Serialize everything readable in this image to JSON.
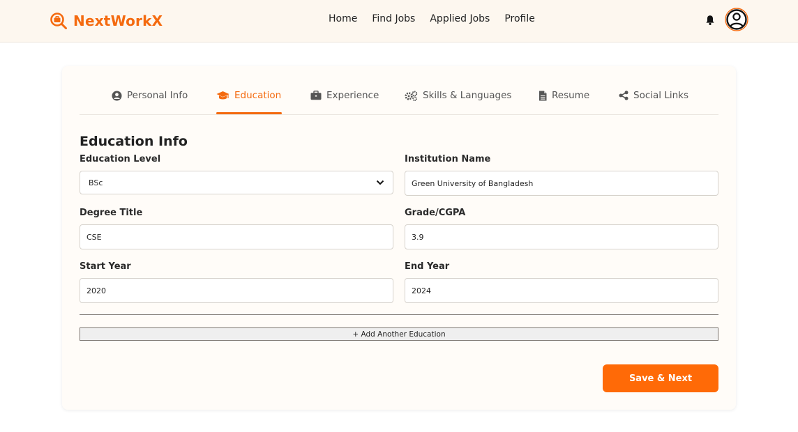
{
  "header": {
    "brand": "NextWorkX",
    "nav": [
      "Home",
      "Find Jobs",
      "Applied Jobs",
      "Profile"
    ]
  },
  "tabs": [
    {
      "label": "Personal Info",
      "icon": "user-circle-icon"
    },
    {
      "label": "Education",
      "icon": "graduation-cap-icon",
      "active": true
    },
    {
      "label": "Experience",
      "icon": "briefcase-icon"
    },
    {
      "label": "Skills & Languages",
      "icon": "gears-icon"
    },
    {
      "label": "Resume",
      "icon": "file-icon"
    },
    {
      "label": "Social Links",
      "icon": "share-icon"
    }
  ],
  "form": {
    "title": "Education Info",
    "education_level": {
      "label": "Education Level",
      "value": "BSc"
    },
    "institution_name": {
      "label": "Institution Name",
      "value": "Green University of Bangladesh"
    },
    "degree_title": {
      "label": "Degree Title",
      "value": "CSE"
    },
    "grade": {
      "label": "Grade/CGPA",
      "value": "3.9"
    },
    "start_year": {
      "label": "Start Year",
      "value": "2020"
    },
    "end_year": {
      "label": "End Year",
      "value": "2024"
    },
    "add_another": "+ Add Another Education",
    "save_next": "Save & Next"
  },
  "colors": {
    "accent": "#f46a0f",
    "button": "#ff6a07",
    "header_bg": "#fdf7ef",
    "card_bg": "#fffcf8"
  }
}
